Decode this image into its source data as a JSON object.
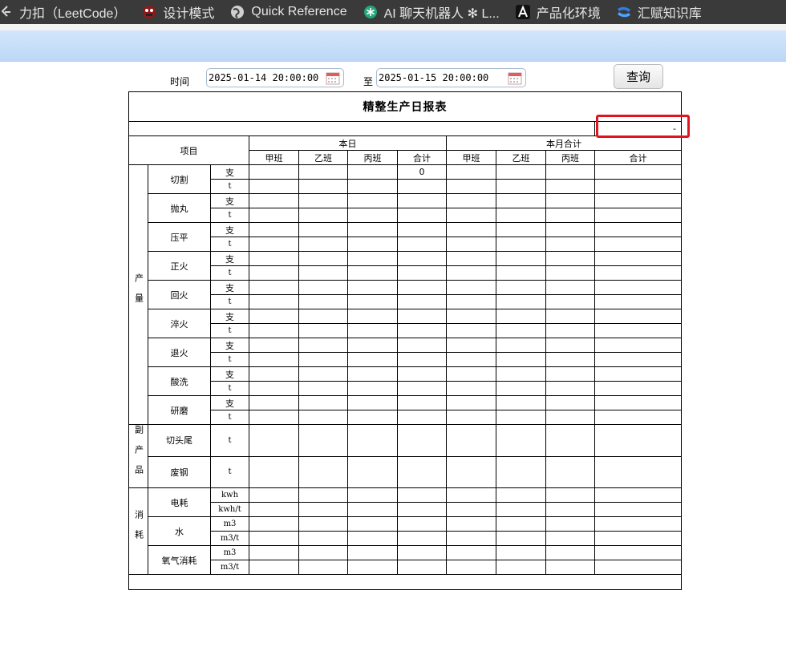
{
  "bookmarks": [
    {
      "icon": "leetcode-icon",
      "label": "力扣（LeetCode）"
    },
    {
      "icon": "design-patterns-icon",
      "label": "设计模式"
    },
    {
      "icon": "globe-icon",
      "label": "Quick Reference"
    },
    {
      "icon": "chatbot-icon",
      "label": "AI 聊天机器人 ✻ L..."
    },
    {
      "icon": "letter-a-icon",
      "label": "产品化环境"
    },
    {
      "icon": "confluence-icon",
      "label": "汇赋知识库"
    }
  ],
  "query": {
    "time_label": "时间",
    "start": "2025-01-14 20:00:00",
    "to_label": "至",
    "end": "2025-01-15 20:00:00",
    "button": "查询"
  },
  "report": {
    "title": "精整生产日报表",
    "dash": "-",
    "item_header": "项目",
    "today_header": "本日",
    "month_header": "本月合计",
    "shifts": [
      "甲班",
      "乙班",
      "丙班",
      "合计"
    ],
    "group_output": "产量",
    "group_byproduct": "副产品",
    "group_consumption": "消耗",
    "output_items": [
      {
        "name": "切割",
        "units": [
          "支",
          "t"
        ],
        "today_total_first": "0"
      },
      {
        "name": "抛丸",
        "units": [
          "支",
          "t"
        ]
      },
      {
        "name": "压平",
        "units": [
          "支",
          "t"
        ]
      },
      {
        "name": "正火",
        "units": [
          "支",
          "t"
        ]
      },
      {
        "name": "回火",
        "units": [
          "支",
          "t"
        ]
      },
      {
        "name": "淬火",
        "units": [
          "支",
          "t"
        ]
      },
      {
        "name": "退火",
        "units": [
          "支",
          "t"
        ]
      },
      {
        "name": "酸洗",
        "units": [
          "支",
          "t"
        ]
      },
      {
        "name": "研磨",
        "units": [
          "支",
          "t"
        ]
      }
    ],
    "byproduct_items": [
      {
        "name": "切头尾",
        "unit": "t"
      },
      {
        "name": "废钢",
        "unit": "t"
      }
    ],
    "consumption_items": [
      {
        "name": "电耗",
        "units": [
          "kwh",
          "kwh/t"
        ]
      },
      {
        "name": "水",
        "units": [
          "m3",
          "m3/t"
        ]
      },
      {
        "name": "氧气消耗",
        "units": [
          "m3",
          "m3/t"
        ]
      }
    ]
  }
}
